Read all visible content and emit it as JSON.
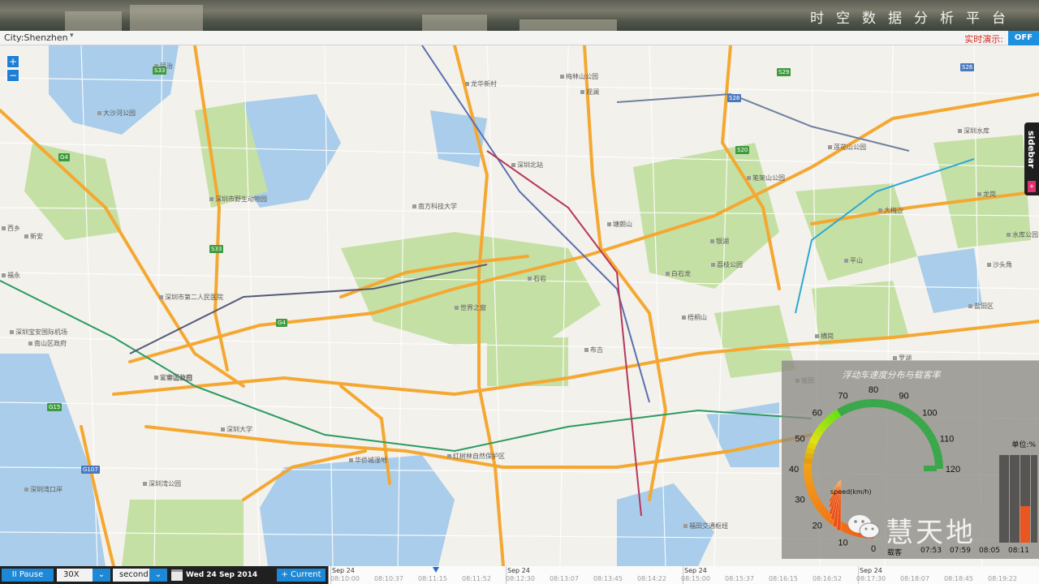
{
  "header": {
    "title": "时空数据分析平台"
  },
  "citybar": {
    "city_label": "City:Shenzhen",
    "city_caret": "▾",
    "realtime_label": "实时演示:",
    "realtime_toggle": "OFF"
  },
  "map": {
    "zoom_in": "+",
    "zoom_out": "−",
    "places": [
      "深圳宝安国际机场",
      "深圳市第二人民医院",
      "深圳市野生动物园",
      "南方科技大学",
      "深圳大学",
      "深圳湾公园",
      "华侨城湿地",
      "红树林自然保护区",
      "福田交通枢纽",
      "深圳北站",
      "龙华新村",
      "梅林山公园",
      "塘朗山",
      "大沙河公园",
      "莲花山公园",
      "笔架山公园",
      "深圳水库",
      "罗湖",
      "沙头角",
      "荔枝公园",
      "世界之窗",
      "白石龙",
      "平山",
      "南山区政府",
      "宝安区政府",
      "中山公园",
      "深圳湾口岸",
      "新安",
      "西乡",
      "福永",
      "石岩",
      "观澜",
      "民治",
      "布吉",
      "横岗",
      "坂田",
      "龙岗",
      "盐田区",
      "大梅沙",
      "银湖",
      "水库公园",
      "梧桐山"
    ],
    "shields": [
      "S33",
      "G4",
      "S28",
      "G15",
      "S20",
      "S26",
      "G4",
      "S33",
      "G107",
      "S29"
    ]
  },
  "sidebar": {
    "label": "sidebar",
    "pin": "+"
  },
  "panel": {
    "title": "浮动车速度分布与载客率",
    "speed_caption": "speed(km/h)",
    "unit_label": "单位:%",
    "gauge_ticks": [
      "0",
      "10",
      "20",
      "30",
      "40",
      "50",
      "60",
      "70",
      "80",
      "90",
      "100",
      "110",
      "120"
    ],
    "time_labels": [
      "07:53",
      "07:59",
      "08:05",
      "08:11"
    ],
    "occupancy_fraction": 0.42,
    "brand": "慧天地",
    "brand_sub": "载客"
  },
  "controls": {
    "pause": "II Pause",
    "speed_value": "30X",
    "unit_value": "second",
    "caret": "⌄",
    "datetime": "Wed 24 Sep 2014 08:11",
    "current": "+ Current",
    "timeline_days": [
      "Sep 24",
      "Sep 24",
      "Sep 24",
      "Sep 24"
    ],
    "timeline_ticks": [
      "08:10:00",
      "08:10:37",
      "08:11:15",
      "08:11:52",
      "08:12:30",
      "08:13:07",
      "08:13:45",
      "08:14:22",
      "08:15:00",
      "08:15:37",
      "08:16:15",
      "08:16:52",
      "08:17:30",
      "08:18:07",
      "08:18:45",
      "08:19:22"
    ]
  },
  "colors": {
    "accent": "#1d88d6",
    "road": "#f4a832",
    "water": "#a9cdea",
    "green": "#c5e0a5",
    "gauge_green": "#3aa84a",
    "gauge_red": "#e0321c"
  }
}
